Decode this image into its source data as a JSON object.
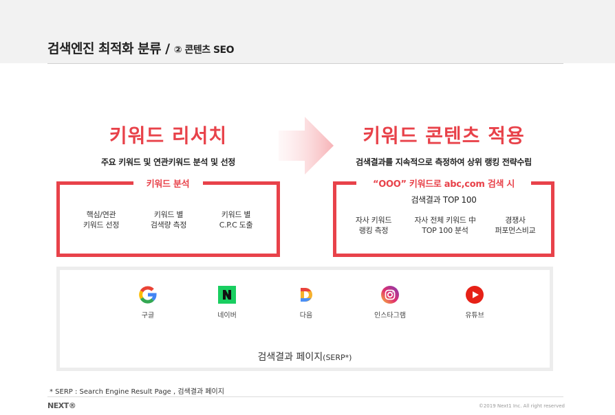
{
  "header": {
    "title": "검색엔진 최적화 분류 /",
    "subtitle": "② 콘텐츠 SEO"
  },
  "left": {
    "heading": "키워드 리서치",
    "subheading": "주요 키워드 및 연관키워드 분석 및 선정",
    "box_label": "키워드 분석",
    "items": [
      "핵심/연관\n키워드 선정",
      "키워드 별\n검색량 측정",
      "키워드 별\nC.P.C 도출"
    ]
  },
  "right": {
    "heading": "키워드 콘텐츠 적용",
    "subheading": "검색결과를 지속적으로 측정하여 상위 랭킹 전략수립",
    "box_label": "“OOO” 키워드로 abc,com 검색 시",
    "box_sublabel": "검색결과 TOP 100",
    "items": [
      "자사 키워드\n랭킹 측정",
      "자사 전체 키워드 中\nTOP 100 분석",
      "경쟁사\n퍼포먼스비교"
    ]
  },
  "serp": {
    "portals": [
      {
        "name": "구글",
        "icon": "google-icon"
      },
      {
        "name": "네이버",
        "icon": "naver-icon"
      },
      {
        "name": "다음",
        "icon": "daum-icon"
      },
      {
        "name": "인스타그램",
        "icon": "instagram-icon"
      },
      {
        "name": "유튜브",
        "icon": "youtube-icon"
      }
    ],
    "title": "검색결과 페이지",
    "title_suffix": "(SERP*)"
  },
  "footer": {
    "footnote": "* SERP : Search Engine Result Page , 검색결과 페이지",
    "logo": "NEXT®",
    "copyright": "©2019 Next1 Inc. All right reserved"
  },
  "colors": {
    "accent": "#e8424a",
    "header_bg": "#f2f2f2",
    "serp_border": "#ededed"
  }
}
